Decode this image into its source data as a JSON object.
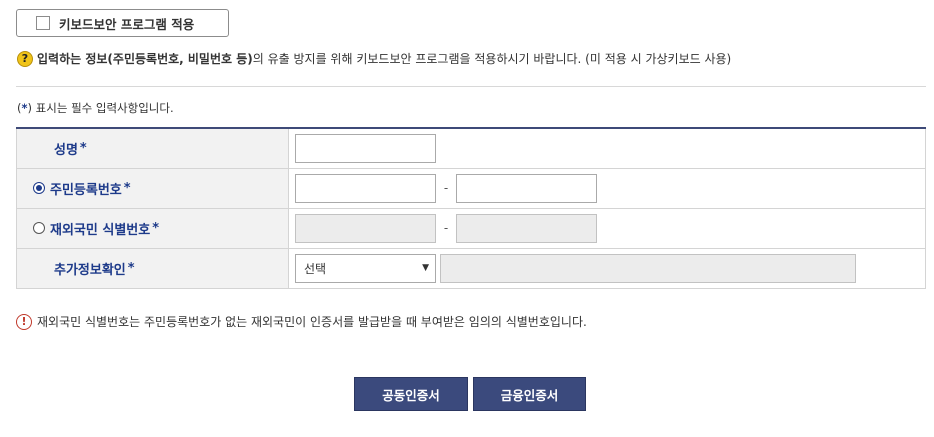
{
  "keyboard_security": {
    "label": "키보드보안 프로그램 적용",
    "checked": false
  },
  "notice": {
    "bold_part": "입력하는 정보(주민등록번호, 비밀번호 등)",
    "rest_part": "의 유출 방지를 위해 키보드보안 프로그램을 적용하시기 바랍니다. (미 적용 시 가상키보드 사용)"
  },
  "required_note": {
    "open": "(",
    "star": "*",
    "close": ")",
    "text": " 표시는 필수 입력사항입니다."
  },
  "form": {
    "star": "*",
    "name_label": "성명",
    "rrn_label": "주민등록번호",
    "foreign_label": "재외국민 식별번호",
    "extra_label": "추가정보확인",
    "dash": "-",
    "select_value": "선택",
    "select_arrow": "▼"
  },
  "warning": {
    "text": "재외국민 식별번호는 주민등록번호가 없는 재외국민이 인증서를 발급받을 때 부여받은 임의의 식별번호입니다."
  },
  "buttons": {
    "joint_cert": "공동인증서",
    "financial_cert": "금융인증서"
  },
  "icons": {
    "question": "?",
    "exclamation": "!"
  },
  "colors": {
    "primary": "#3b4a7d",
    "label": "#1d3a8a",
    "notice_icon": "#f0c419",
    "warn_icon": "#c0392b"
  }
}
